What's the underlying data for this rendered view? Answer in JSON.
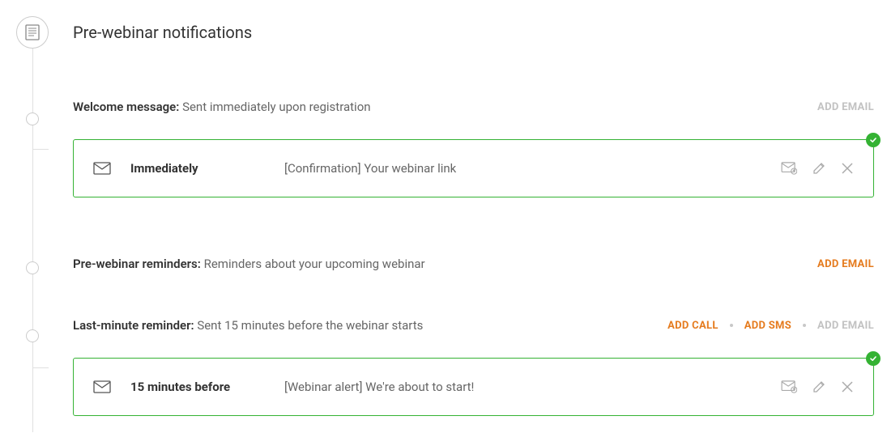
{
  "page": {
    "title": "Pre-webinar notifications"
  },
  "sections": {
    "welcome": {
      "label": "Welcome message:",
      "desc": "Sent immediately upon registration",
      "actions": {
        "add_email": "ADD EMAIL"
      },
      "card": {
        "timing": "Immediately",
        "subject": "[Confirmation] Your webinar link"
      }
    },
    "reminders": {
      "label": "Pre-webinar reminders:",
      "desc": "Reminders about your upcoming webinar",
      "actions": {
        "add_email": "ADD EMAIL"
      }
    },
    "lastminute": {
      "label": "Last-minute reminder:",
      "desc": "Sent 15 minutes before the webinar starts",
      "actions": {
        "add_call": "ADD CALL",
        "add_sms": "ADD SMS",
        "add_email": "ADD EMAIL"
      },
      "card": {
        "timing": "15 minutes before",
        "subject": "[Webinar alert] We're about to start!"
      }
    }
  }
}
